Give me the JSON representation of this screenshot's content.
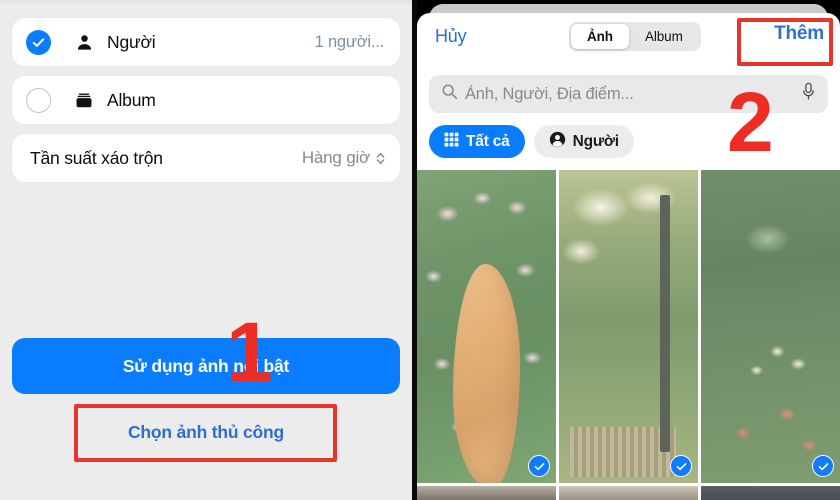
{
  "left_panel": {
    "rows": [
      {
        "label": "Người",
        "tail": "1 người...",
        "selected": true,
        "icon": "person-icon"
      },
      {
        "label": "Album",
        "tail": "",
        "selected": false,
        "icon": "album-icon"
      }
    ],
    "shuffle_row": {
      "label": "Tần suất xáo trộn",
      "value": "Hàng giờ",
      "chevron": "chevron-up-down-icon"
    },
    "primary_button": "Sử dụng ảnh nổi bật",
    "secondary_button": "Chọn ảnh thủ công"
  },
  "right_panel": {
    "navbar": {
      "cancel": "Hủy",
      "add": "Thêm",
      "segments": [
        {
          "label": "Ảnh",
          "active": true
        },
        {
          "label": "Album",
          "active": false
        }
      ]
    },
    "search": {
      "placeholder": "Ảnh, Người, Địa điểm...",
      "value": "",
      "search_icon": "search-icon",
      "mic_icon": "microphone-icon"
    },
    "chips": [
      {
        "label": "Tất cả",
        "icon": "grid-icon",
        "active": true
      },
      {
        "label": "Người",
        "icon": "person-icon",
        "active": false
      }
    ],
    "photo_grid": {
      "columns": 3,
      "cells": [
        {
          "name": "photo-cat-roses",
          "selected": true
        },
        {
          "name": "photo-garden-gate",
          "selected": true
        },
        {
          "name": "photo-rose-bush",
          "selected": true
        }
      ],
      "partial_row": [
        {
          "name": "photo-partial-1"
        },
        {
          "name": "photo-partial-2"
        },
        {
          "name": "photo-partial-3"
        }
      ],
      "check_icon": "checkmark-circle-icon"
    }
  },
  "annotations": {
    "step_one": "1",
    "step_two": "2",
    "color": "#ed2d24"
  },
  "colors": {
    "accent_blue": "#0a7cff",
    "link_blue": "#2b6fd4",
    "panel_bg": "#ececec",
    "annotation_red": "#ed2d24"
  }
}
